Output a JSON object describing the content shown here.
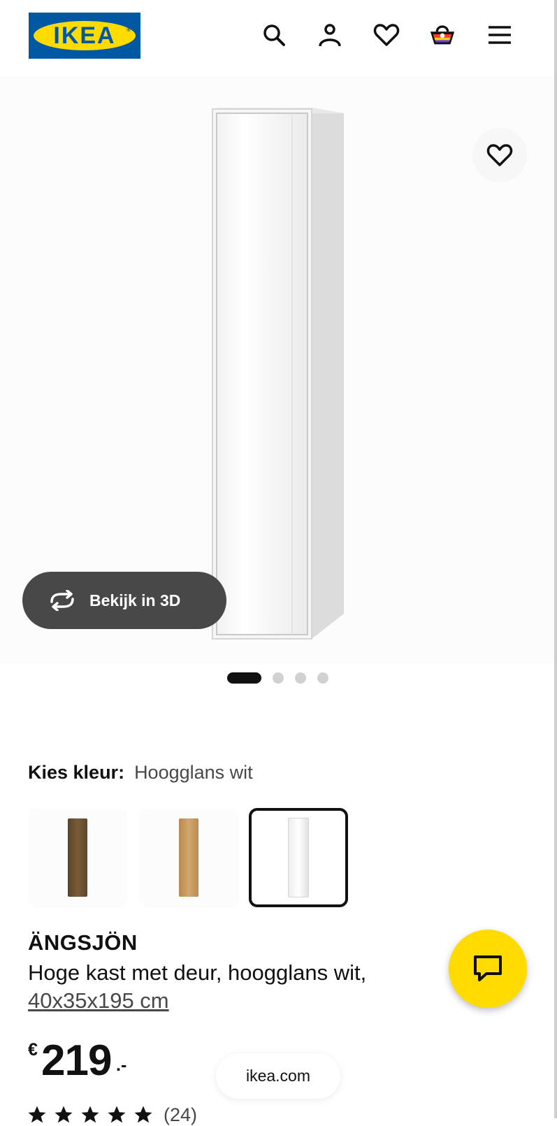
{
  "brand": {
    "logo_text": "IKEA"
  },
  "header": {
    "icons": [
      "search-icon",
      "account-icon",
      "heart-icon",
      "basket-icon",
      "menu-icon"
    ]
  },
  "gallery": {
    "view_3d_label": "Bekijk in 3D",
    "slide_count": 4,
    "active_slide": 1
  },
  "color_chooser": {
    "label": "Kies kleur:",
    "selected": "Hoogglans wit",
    "options": [
      {
        "name": "dark-wood",
        "color": "#6b5233"
      },
      {
        "name": "oak",
        "color": "#c79a5b"
      },
      {
        "name": "white",
        "color": "#f4f4f4",
        "selected": true
      }
    ]
  },
  "product": {
    "name": "ÄNGSJÖN",
    "description": "Hoge kast met deur, hoogglans wit,",
    "dimensions": "40x35x195 cm",
    "price_currency": "€",
    "price_integer": "219",
    "price_decimal": ".-",
    "rating_stars": 5,
    "review_count": "(24)"
  },
  "browser": {
    "url": "ikea.com"
  },
  "colors": {
    "ikea_blue": "#0058a3",
    "ikea_yellow": "#ffdb00"
  }
}
